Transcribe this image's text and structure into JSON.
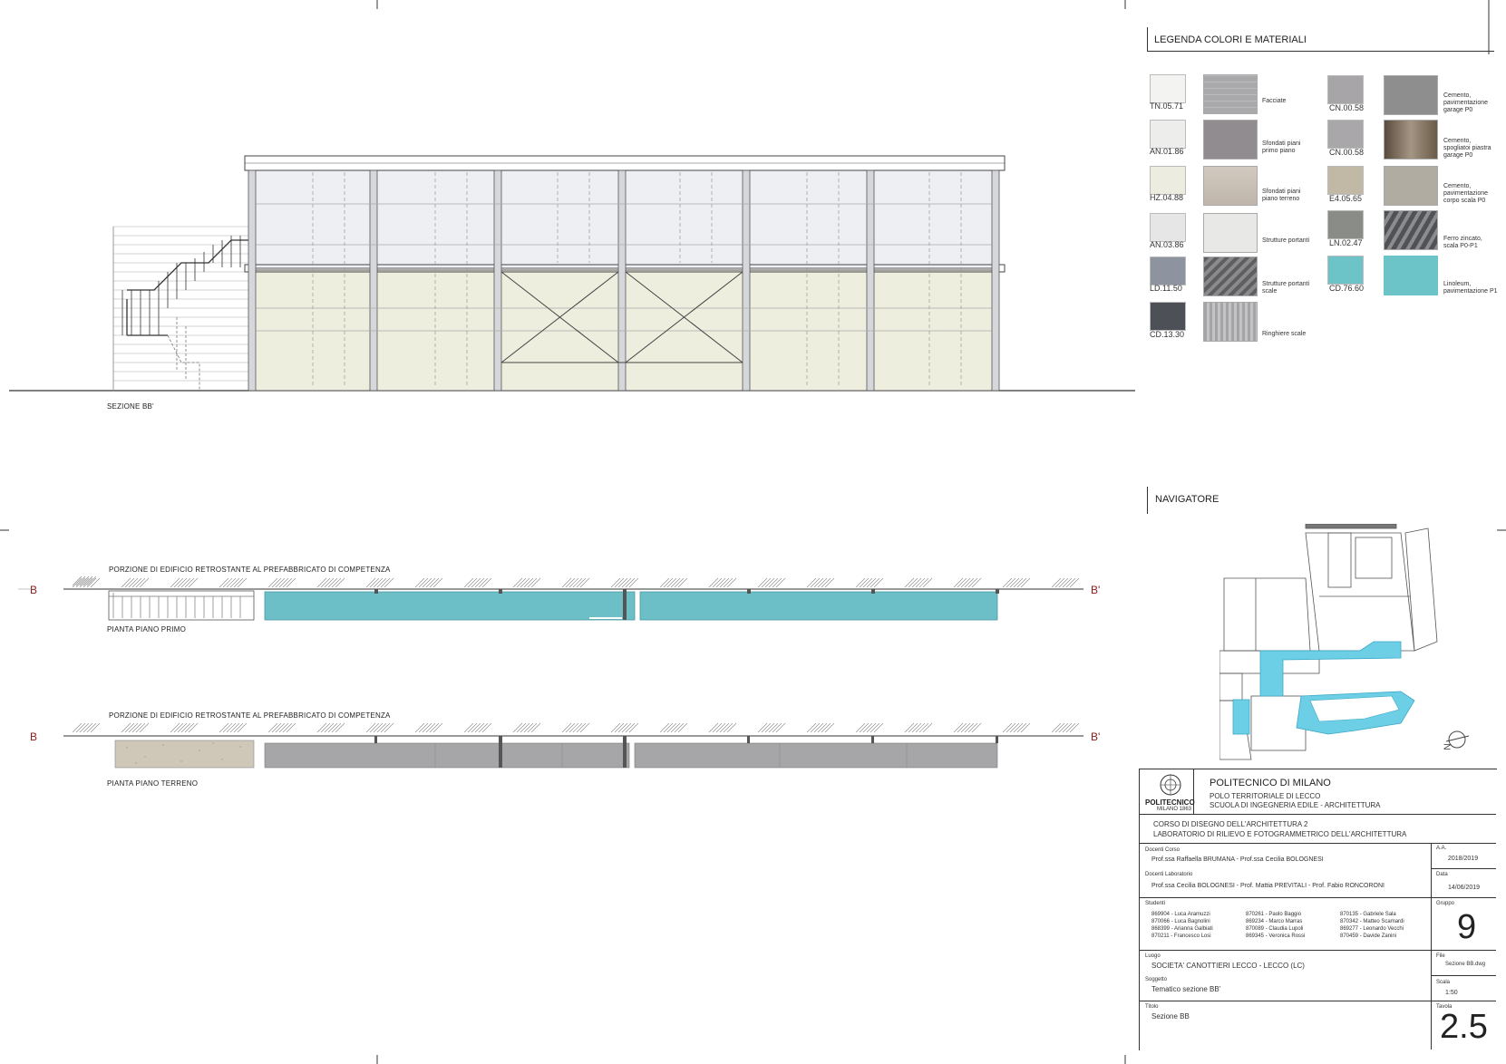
{
  "section": {
    "label": "SEZIONE BB'"
  },
  "plans": {
    "upper": {
      "portion_label": "PORZIONE DI EDIFICIO RETROSTANTE AL PREFABBRICATO DI COMPETENZA",
      "plan_label": "PIANTA PIANO PRIMO",
      "marker_left": "B",
      "marker_right": "B'"
    },
    "lower": {
      "portion_label": "PORZIONE DI EDIFICIO RETROSTANTE AL PREFABBRICATO DI COMPETENZA",
      "plan_label": "PIANTA PIANO TERRENO",
      "marker_left": "B",
      "marker_right": "B'"
    }
  },
  "legend": {
    "title": "LEGENDA COLORI E MATERIALI",
    "left_swatches": [
      {
        "code": "TN.05.71",
        "color": "#f3f3f2",
        "material": "Facciate",
        "texture": "#a9a9ab"
      },
      {
        "code": "AN.01.86",
        "color": "#ededec",
        "material": "Sfondati piani primo piano",
        "texture": "#908c90"
      },
      {
        "code": "HZ.04.88",
        "color": "#ecede0",
        "material": "Sfondati piani piano terreno",
        "texture": "#c9c0b6"
      },
      {
        "code": "AN.03.86",
        "color": "#e6e6e6",
        "material": "Strutture portanti",
        "texture": "#e8e8e6"
      },
      {
        "code": "LD.11.50",
        "color": "#8d94a0",
        "material": "Strutture portanti scale",
        "texture": "#6e6e70"
      },
      {
        "code": "CD.13.30",
        "color": "#4e5058",
        "material": "Ringhiere scale",
        "texture": "#b4b4b6"
      }
    ],
    "right_swatches": [
      {
        "code": "CN.00.58",
        "color": "#a7a5a7",
        "material": "Cemento, pavimentazione garage P0",
        "texture": "#8e8e8e"
      },
      {
        "code": "CN.00.58",
        "color": "#a9a7a9",
        "material": "Cemento, spogliatoi piastra garage P0",
        "texture": "#7a6e60"
      },
      {
        "code": "E4.05.65",
        "color": "#c2b8a6",
        "material": "Cemento, pavimentazione corpo scala P0",
        "texture": "#b1aca2"
      },
      {
        "code": "LN.02.47",
        "color": "#8a8c88",
        "material": "Ferro zincato, scala P0-P1",
        "texture": "#66676c"
      },
      {
        "code": "CD.76.60",
        "color": "#6cc4c8",
        "material": "Linoleum, pavimentazione P1",
        "texture": "#6cc4c8"
      }
    ]
  },
  "navigator": {
    "title": "NAVIGATORE",
    "north": "N"
  },
  "title_block": {
    "university": "POLITECNICO DI MILANO",
    "logo_text": "POLITECNICO",
    "logo_sub": "MILANO 1863",
    "campus": "POLO TERRITORIALE DI LECCO",
    "school": "SCUOLA DI INGEGNERIA EDILE - ARCHITETTURA",
    "course": "CORSO DI DISEGNO DELL'ARCHITETTURA 2",
    "lab": "LABORATORIO DI RILIEVO E FOTOGRAMMETRICO DELL'ARCHITETTURA",
    "docenti_label": "Docenti Corso",
    "docenti": "Prof.ssa Raffaella BRUMANA - Prof.ssa Cecilia BOLOGNESI",
    "lab_docenti_label": "Docenti Laboratorio",
    "lab_docenti": "Prof.ssa Cecilia BOLOGNESI - Prof. Mattia PREVITALI - Prof. Fabio RONCORONI",
    "aa_label": "A.A.",
    "aa": "2018/2019",
    "date_label": "Data",
    "date": "14/06/2019",
    "authors_label": "Studenti",
    "authors": [
      "869904 - Luca Aramuzzi",
      "870066 - Luca Bagnolini",
      "868399 - Arianna Galbiati",
      "870211 - Francesco Losi",
      "870261 - Paolo Baggio",
      "869234 - Marco Marras",
      "870089 - Claudia Lupoli",
      "869345 - Veronica Rossi",
      "870135 - Gabriele Sala",
      "870342 - Matteo Scamardi",
      "869277 - Leonardo Vecchi",
      "870459 - Davide Zanini"
    ],
    "group_label": "Gruppo",
    "group": "9",
    "luogo_label": "Luogo",
    "luogo": "SOCIETA' CANOTTIERI LECCO - LECCO (LC)",
    "soggetto_label": "Soggetto",
    "soggetto": "Tematico sezione BB'",
    "file_label": "File",
    "file": "Sezione BB.dwg",
    "scala_label": "Scala",
    "scala": "1:50",
    "titolo_label": "Titolo",
    "titolo": "Sezione BB",
    "tavola_label": "Tavola",
    "tavola": "2.5"
  }
}
